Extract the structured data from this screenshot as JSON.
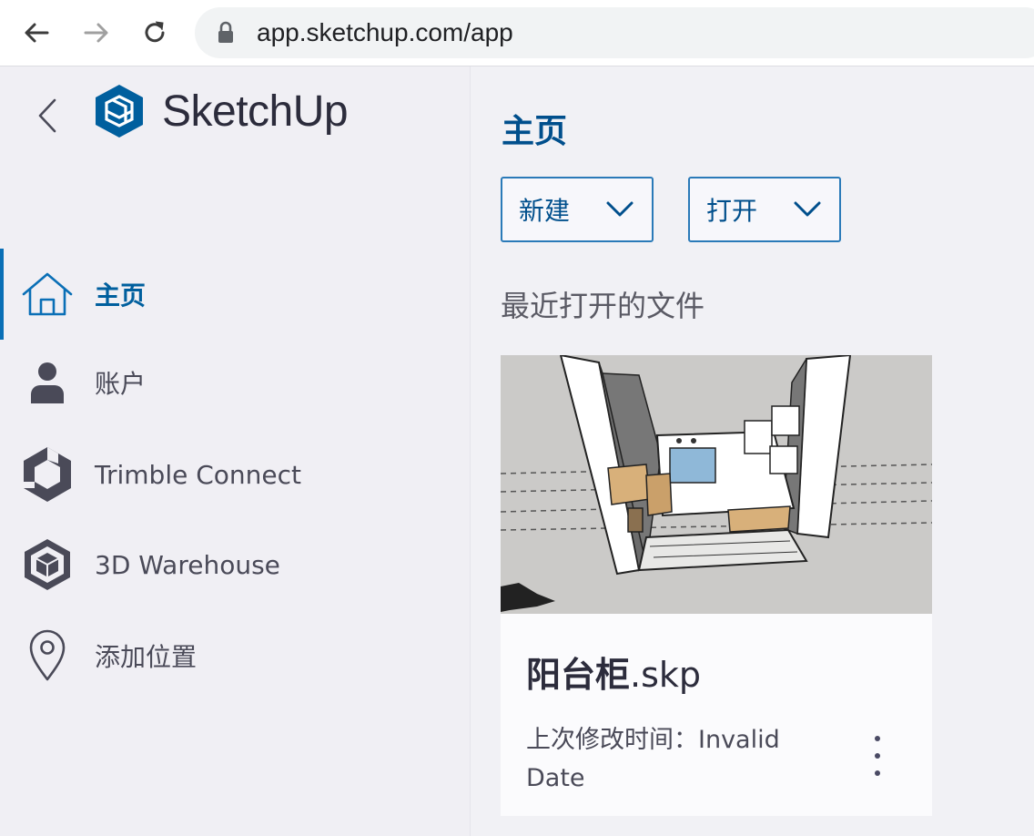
{
  "browser": {
    "url": "app.sketchup.com/app",
    "back_icon": "arrow-left-icon",
    "forward_icon": "arrow-right-icon",
    "reload_icon": "reload-icon",
    "lock_icon": "lock-icon"
  },
  "sidebar": {
    "logo_text": "SketchUp",
    "items": [
      {
        "label": "主页",
        "icon": "home-icon",
        "active": true
      },
      {
        "label": "账户",
        "icon": "user-icon",
        "active": false
      },
      {
        "label": "Trimble Connect",
        "icon": "trimble-connect-icon",
        "active": false
      },
      {
        "label": "3D Warehouse",
        "icon": "3d-warehouse-icon",
        "active": false
      },
      {
        "label": "添加位置",
        "icon": "location-pin-icon",
        "active": false
      }
    ]
  },
  "main": {
    "title": "主页",
    "new_button": "新建",
    "open_button": "打开",
    "recent_title": "最近打开的文件",
    "file": {
      "name_bold": "阳台柜",
      "name_ext": ".skp",
      "modified_label": "上次修改时间：",
      "modified_value": "Invalid Date"
    }
  },
  "colors": {
    "accent": "#005f9e",
    "sidebar_bg": "#f0eff4",
    "active_bar": "#0a6fb6"
  }
}
